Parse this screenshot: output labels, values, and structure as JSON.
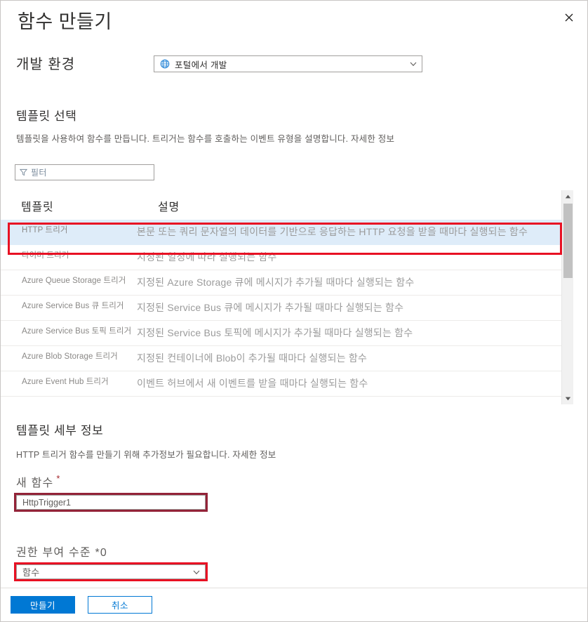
{
  "blade": {
    "title": "함수 만들기",
    "close_icon": "close-icon"
  },
  "dev_environment": {
    "label": "개발 환경",
    "selected": "포털에서 개발",
    "icon": "globe-icon",
    "chevron": "chevron-down-icon"
  },
  "select_template": {
    "title": "템플릿 선택",
    "description": "템플릿을 사용하여 함수를 만듭니다. 트리거는 함수를 호출하는 이벤트 유형을 설명합니다. ",
    "learn_more": "자세한 정보",
    "filter": {
      "placeholder": "필터",
      "value": "",
      "icon": "filter-icon"
    },
    "columns": [
      "템플릿",
      "설명"
    ],
    "rows": [
      {
        "name": "HTTP 트리거",
        "description": "본문 또는 쿼리 문자열의 데이터를 기반으로 응답하는 HTTP 요청을 받을 때마다 실행되는 함수",
        "selected": true
      },
      {
        "name": "타이머 트리거",
        "description": "지정된 일정에 따라 실행되는 함수",
        "selected": false
      },
      {
        "name": "Azure Queue Storage 트리거",
        "description": "지정된 Azure Storage 큐에 메시지가 추가될 때마다 실행되는 함수",
        "selected": false
      },
      {
        "name": "Azure Service Bus 큐 트리거",
        "description": "지정된 Service Bus 큐에 메시지가 추가될 때마다 실행되는 함수",
        "selected": false
      },
      {
        "name": "Azure Service Bus 토픽 트리거",
        "description": "지정된 Service Bus 토픽에 메시지가 추가될 때마다 실행되는 함수",
        "selected": false
      },
      {
        "name": "Azure Blob Storage 트리거",
        "description": "지정된 컨테이너에 Blob이 추가될 때마다 실행되는 함수",
        "selected": false
      },
      {
        "name": "Azure Event Hub 트리거",
        "description": "이벤트 허브에서 새 이벤트를 받을 때마다 실행되는 함수",
        "selected": false
      }
    ],
    "scrollbar": {
      "up_icon": "scroll-up-arrow-icon",
      "down_icon": "scroll-down-arrow-icon"
    }
  },
  "template_details": {
    "title": "템플릿 세부 정보",
    "description": "HTTP 트리거 함수를 만들기 위해 추가정보가 필요합니다. ",
    "learn_more": "자세한 정보",
    "new_function": {
      "label": "새 함수",
      "required_marker": "*",
      "value": "HttpTrigger1",
      "placeholder": "HttpTrigger1"
    },
    "auth_level": {
      "label": "권한 부여 수준 *0",
      "selected": "함수",
      "chevron": "chevron-down-icon"
    }
  },
  "footer": {
    "create_label": "만들기",
    "cancel_label": "취소"
  },
  "colors": {
    "accent": "#0078d4",
    "selected_row": "#deecf9",
    "annotation_red": "#e81123",
    "annotation_dark_red": "#932338",
    "required_star": "#a4262c"
  }
}
